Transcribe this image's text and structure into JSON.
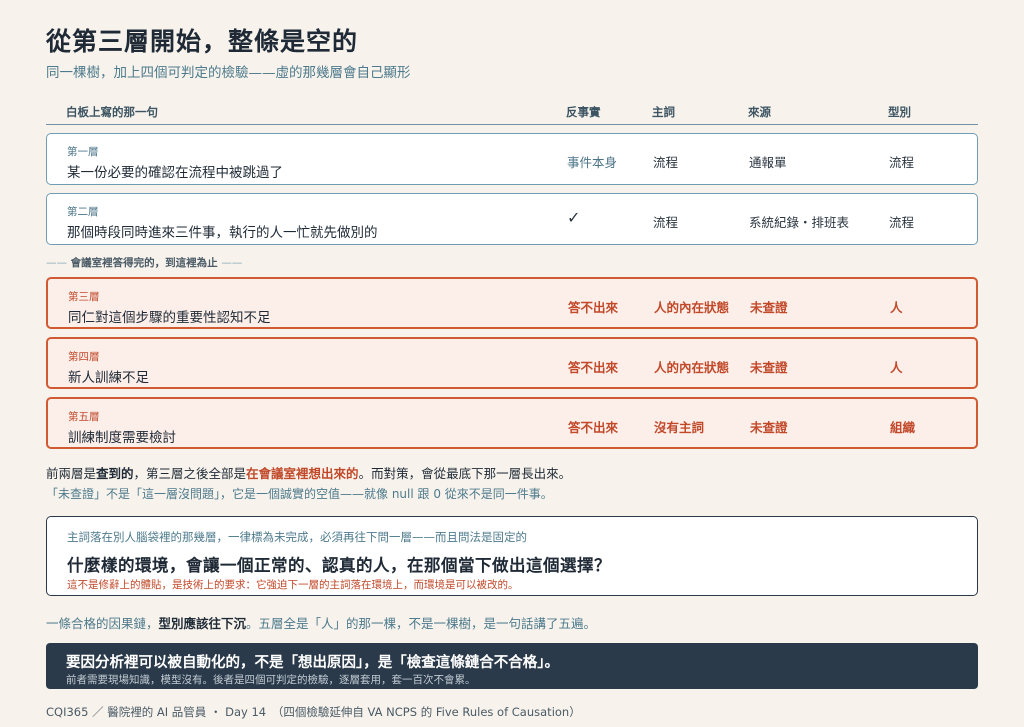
{
  "title": "從第三層開始，整條是空的",
  "subtitle": "同一棵樹，加上四個可判定的檢驗——虛的那幾層會自己顯形",
  "table": {
    "headers": [
      "白板上寫的那一句",
      "反事實",
      "主詞",
      "來源",
      "型別"
    ],
    "rows": [
      {
        "level": "第一層",
        "text": "某一份必要的確認在流程中被跳過了",
        "counterfactual": "事件本身",
        "subject": "流程",
        "source": "通報單",
        "type": "流程"
      },
      {
        "level": "第二層",
        "text": "那個時段同時進來三件事，執行的人一忙就先做別的",
        "counterfactual": "✓",
        "subject": "流程",
        "source": "系統紀錄・排班表",
        "type": "流程"
      },
      {
        "level": "第三層",
        "text": "同仁對這個步驟的重要性認知不足",
        "counterfactual": "答不出來",
        "subject": "人的內在狀態",
        "source": "未查證",
        "type": "人"
      },
      {
        "level": "第四層",
        "text": "新人訓練不足",
        "counterfactual": "答不出來",
        "subject": "人的內在狀態",
        "source": "未查證",
        "type": "人"
      },
      {
        "level": "第五層",
        "text": "訓練制度需要檢討",
        "counterfactual": "答不出來",
        "subject": "沒有主詞",
        "source": "未查證",
        "type": "組織"
      }
    ],
    "divider_dash": "——",
    "divider_label": "會議室裡答得完的，到這裡為止"
  },
  "para1": {
    "a": "前兩層是",
    "b": "查到的",
    "c": "，第三層之後全部是",
    "d": "在會議室裡想出來的",
    "e": "。而對策，會從最底下那一層長出來。"
  },
  "para2": "「未查證」不是「這一層沒問題」，它是一個誠實的空值——就像 null 跟 0 從來不是同一件事。",
  "question_box": {
    "intro": "主詞落在別人腦袋裡的那幾層，一律標為未完成，必須再往下問一層——而且問法是固定的",
    "question": "什麼樣的環境，會讓一個正常的、認真的人，在那個當下做出這個選擇？",
    "note": "這不是修辭上的體貼，是技術上的要求：它強迫下一層的主詞落在環境上，而環境是可以被改的。"
  },
  "para3": {
    "a": "一條合格的因果鏈，",
    "b": "型別應該往下沉",
    "c": "。五層全是「人」的那一棵，不是一棵樹，是一句話講了五遍。"
  },
  "conclusion": {
    "main": "要因分析裡可以被自動化的，不是「想出原因」，是「檢查這條鏈合不合格」。",
    "sub": "前者需要現場知識，模型沒有。後者是四個可判定的檢驗，逐層套用，套一百次不會累。"
  },
  "footer": "CQI365 ／ 醫院裡的 AI 品管員 ・ Day 14　（四個檢驗延伸自 VA NCPS 的 Five Rules of Causation）",
  "colors": {
    "accent_red": "#c1492a",
    "accent_teal": "#4d7a8c",
    "dark_navy": "#2a3a4a",
    "background": "#f7f3ec"
  }
}
